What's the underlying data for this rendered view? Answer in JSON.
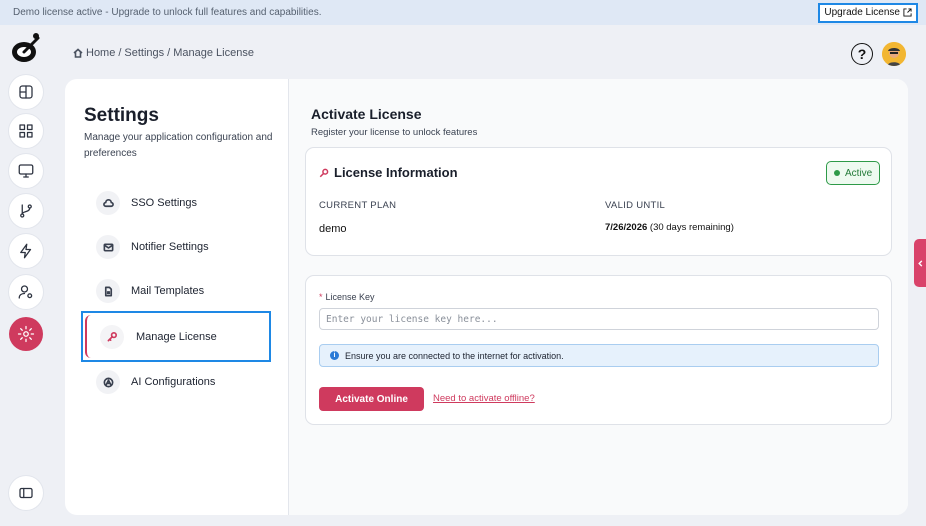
{
  "banner": {
    "text": "Demo license active - Upgrade to unlock full features and capabilities.",
    "upgrade_label": "Upgrade License"
  },
  "breadcrumb": [
    "Home",
    "Settings",
    "Manage License"
  ],
  "breadcrumb_sep": "/",
  "header": {
    "help_glyph": "?"
  },
  "rail": {
    "items": [
      "layout-grid-icon",
      "dashboard-icon",
      "monitor-icon",
      "git-branch-icon",
      "lightning-icon",
      "user-settings-icon",
      "gear-icon"
    ],
    "active": "gear-icon",
    "bottom": "sidebar-toggle-icon"
  },
  "settings": {
    "title": "Settings",
    "description": "Manage your application configuration and preferences",
    "menu": [
      {
        "label": "SSO Settings",
        "icon": "cloud-icon"
      },
      {
        "label": "Notifier Settings",
        "icon": "mail-icon"
      },
      {
        "label": "Mail Templates",
        "icon": "file-icon"
      },
      {
        "label": "Manage License",
        "icon": "key-icon",
        "selected": true
      },
      {
        "label": "AI Configurations",
        "icon": "ai-icon"
      }
    ]
  },
  "activate": {
    "title": "Activate License",
    "subtitle": "Register your license to unlock features"
  },
  "license_info": {
    "title": "License Information",
    "status": "Active",
    "plan_label": "CURRENT PLAN",
    "plan_value": "demo",
    "valid_label": "VALID UNTIL",
    "valid_date": "7/26/2026",
    "valid_remaining": "(30 days remaining)"
  },
  "license_form": {
    "required_mark": "*",
    "key_label": "License Key",
    "key_placeholder": "Enter your license key here...",
    "notice_glyph": "i",
    "notice": "Ensure you are connected to the internet for activation.",
    "activate_label": "Activate Online",
    "offline_link": "Need to activate offline?"
  },
  "colors": {
    "accent": "#cf3a5e",
    "focus": "#1e88e5",
    "success": "#2e9a48",
    "info": "#2a7ad6"
  }
}
